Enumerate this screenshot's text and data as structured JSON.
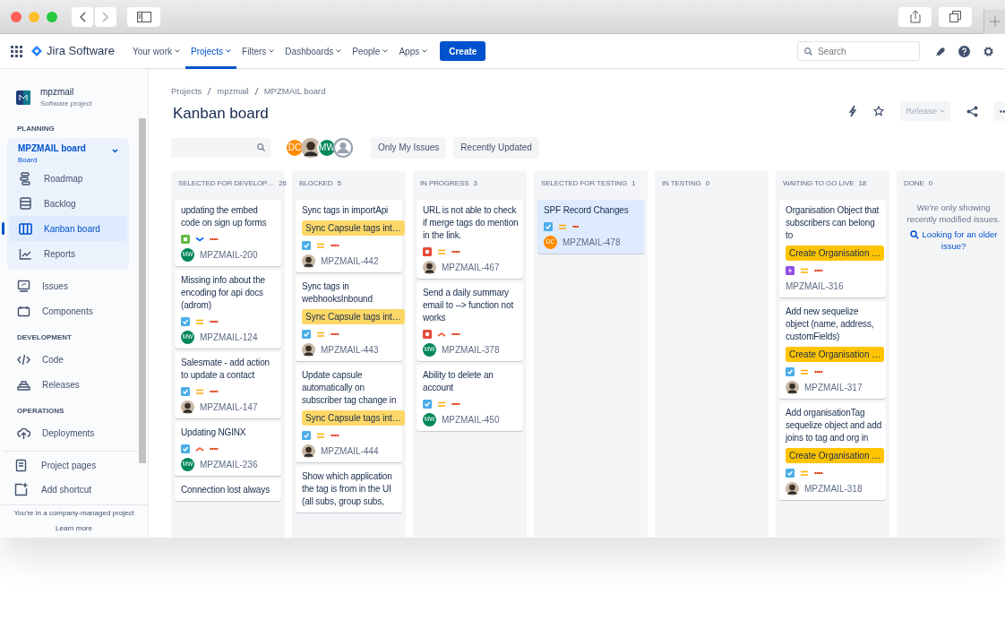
{
  "nav": {
    "product": "Jira Software",
    "menu": [
      {
        "label": "Your work",
        "selected": false
      },
      {
        "label": "Projects",
        "selected": true
      },
      {
        "label": "Filters",
        "selected": false
      },
      {
        "label": "Dashboards",
        "selected": false
      },
      {
        "label": "People",
        "selected": false
      },
      {
        "label": "Apps",
        "selected": false
      }
    ],
    "create": "Create",
    "search": {
      "placeholder": "Search"
    }
  },
  "sidebar": {
    "project": {
      "name": "mpzmail",
      "type": "Software project"
    },
    "sections": [
      {
        "heading": "PLANNING",
        "board": {
          "name": "MPZMAIL board",
          "subtitle": "Board",
          "expanded": true,
          "items": [
            {
              "label": "Roadmap",
              "kind": "roadmap",
              "selected": false
            },
            {
              "label": "Backlog",
              "kind": "backlog",
              "selected": false
            },
            {
              "label": "Kanban board",
              "kind": "board",
              "selected": true
            },
            {
              "label": "Reports",
              "kind": "reports",
              "selected": false
            }
          ]
        },
        "items": [
          {
            "label": "Issues",
            "kind": "issues"
          },
          {
            "label": "Components",
            "kind": "components"
          }
        ]
      },
      {
        "heading": "DEVELOPMENT",
        "items": [
          {
            "label": "Code",
            "kind": "code"
          },
          {
            "label": "Releases",
            "kind": "releases"
          }
        ]
      },
      {
        "heading": "OPERATIONS",
        "items": [
          {
            "label": "Deployments",
            "kind": "deployments"
          }
        ]
      }
    ],
    "bottom_items": [
      {
        "label": "Project pages",
        "kind": "pages"
      },
      {
        "label": "Add shortcut",
        "kind": "shortcut"
      }
    ],
    "footer": {
      "text": "You're in a company-managed project",
      "link": "Learn more"
    }
  },
  "page": {
    "breadcrumbs": [
      "Projects",
      "mpzmail",
      "MPZMAIL board"
    ],
    "title": "Kanban board",
    "release": {
      "label": "Release",
      "disabled": true
    },
    "filters": {
      "avatars": [
        {
          "kind": "initials",
          "initials": "DC",
          "color": "#ff8b00"
        },
        {
          "kind": "photo"
        },
        {
          "kind": "initials",
          "initials": "MW",
          "color": "#00875a"
        },
        {
          "kind": "generic"
        }
      ],
      "buttons": [
        "Only My Issues",
        "Recently Updated"
      ]
    }
  },
  "columns": [
    {
      "title": "SELECTED FOR DEVELOP…",
      "count": "26",
      "cards": [
        {
          "title": "updating the embed code on sign up forms",
          "type": {
            "kind": "story"
          },
          "priority": {
            "kind": "low"
          },
          "points": "••••",
          "assignee": {
            "kind": "initials",
            "initials": "MW",
            "color": "#00875a"
          },
          "key": "MPZMAIL-200",
          "selected": false
        },
        {
          "title": "Missing info about the encoding for api docs (adrom)",
          "type": {
            "kind": "task"
          },
          "priority": {
            "kind": "medium"
          },
          "points": "••••",
          "assignee": {
            "kind": "initials",
            "initials": "MW",
            "color": "#00875a"
          },
          "key": "MPZMAIL-124",
          "selected": false
        },
        {
          "title": "Salesmate - add action to update a contact",
          "type": {
            "kind": "task"
          },
          "priority": {
            "kind": "medium"
          },
          "points": "••••",
          "assignee": {
            "kind": "photo"
          },
          "key": "MPZMAIL-147",
          "selected": false
        },
        {
          "title": "Updating NGINX",
          "type": {
            "kind": "task"
          },
          "priority": {
            "kind": "high"
          },
          "points": "••••",
          "assignee": {
            "kind": "initials",
            "initials": "MW",
            "color": "#00875a"
          },
          "key": "MPZMAIL-236",
          "selected": false
        },
        {
          "title": "Connection lost always",
          "selected": false
        }
      ]
    },
    {
      "title": "BLOCKED",
      "count": "5",
      "cards": [
        {
          "title": "Sync tags in importApi",
          "epic": {
            "label": "Sync Capsule tags int…",
            "color": "#fdd868"
          },
          "type": {
            "kind": "task"
          },
          "priority": {
            "kind": "medium"
          },
          "points": "••••",
          "assignee": {
            "kind": "photo"
          },
          "key": "MPZMAIL-442",
          "selected": false
        },
        {
          "title": "Sync tags in webhooksInbound",
          "epic": {
            "label": "Sync Capsule tags int…",
            "color": "#fdd868"
          },
          "type": {
            "kind": "task"
          },
          "priority": {
            "kind": "medium"
          },
          "points": "••••",
          "assignee": {
            "kind": "photo"
          },
          "key": "MPZMAIL-443",
          "selected": false
        },
        {
          "title": "Update capsule automatically on subscriber tag change in",
          "epic": {
            "label": "Sync Capsule tags int…",
            "color": "#fdd868"
          },
          "type": {
            "kind": "task"
          },
          "priority": {
            "kind": "medium"
          },
          "points": "••••",
          "assignee": {
            "kind": "photo"
          },
          "key": "MPZMAIL-444",
          "selected": false
        },
        {
          "title": "Show which application the tag is from in the UI (all subs, group subs,",
          "selected": false
        }
      ]
    },
    {
      "title": "IN PROGRESS",
      "count": "3",
      "cards": [
        {
          "title": "URL is not able to check if merge tags do mention in the link.",
          "type": {
            "kind": "bug"
          },
          "priority": {
            "kind": "medium"
          },
          "points": "••••",
          "assignee": {
            "kind": "photo"
          },
          "key": "MPZMAIL-467",
          "selected": false
        },
        {
          "title": "Send a daily summary email to --> function not works",
          "type": {
            "kind": "bug"
          },
          "priority": {
            "kind": "high"
          },
          "points": "••••",
          "assignee": {
            "kind": "initials",
            "initials": "MW",
            "color": "#00875a"
          },
          "key": "MPZMAIL-378",
          "selected": false
        },
        {
          "title": "Ability to delete an account",
          "type": {
            "kind": "task"
          },
          "priority": {
            "kind": "medium"
          },
          "points": "••••",
          "assignee": {
            "kind": "initials",
            "initials": "MW",
            "color": "#00875a"
          },
          "key": "MPZMAIL-450",
          "selected": false
        }
      ]
    },
    {
      "title": "SELECTED FOR TESTING",
      "count": "1",
      "cards": [
        {
          "title": "SPF Record Changes",
          "type": {
            "kind": "task"
          },
          "priority": {
            "kind": "medium"
          },
          "points": "•••",
          "assignee": {
            "kind": "initials",
            "initials": "DC",
            "color": "#ff8b00"
          },
          "key": "MPZMAIL-478",
          "selected": true
        }
      ]
    },
    {
      "title": "IN TESTING",
      "count": "0"
    },
    {
      "title": "WAITING TO GO LIVE",
      "count": "18",
      "cards": [
        {
          "title": "Organisation Object that subscribers can belong to",
          "epic": {
            "label": "Create Organisation …",
            "color": "#ffc400"
          },
          "type": {
            "kind": "epic"
          },
          "priority": {
            "kind": "medium"
          },
          "points": "••••",
          "key": "MPZMAIL-316",
          "selected": false
        },
        {
          "title": "Add new sequelize object (name, address, customFields)",
          "epic": {
            "label": "Create Organisation …",
            "color": "#ffc400"
          },
          "type": {
            "kind": "task"
          },
          "priority": {
            "kind": "medium"
          },
          "points": "••••",
          "assignee": {
            "kind": "photo"
          },
          "key": "MPZMAIL-317",
          "selected": false
        },
        {
          "title": "Add organisationTag sequelize object and add joins to tag and org in",
          "epic": {
            "label": "Create Organisation …",
            "color": "#ffc400"
          },
          "type": {
            "kind": "task"
          },
          "priority": {
            "kind": "medium"
          },
          "points": "••••",
          "assignee": {
            "kind": "photo"
          },
          "key": "MPZMAIL-318",
          "selected": false
        }
      ]
    },
    {
      "title": "DONE",
      "count": "0",
      "note": "We're only showing recently modified issues.",
      "link": "Looking for an older issue?"
    }
  ]
}
